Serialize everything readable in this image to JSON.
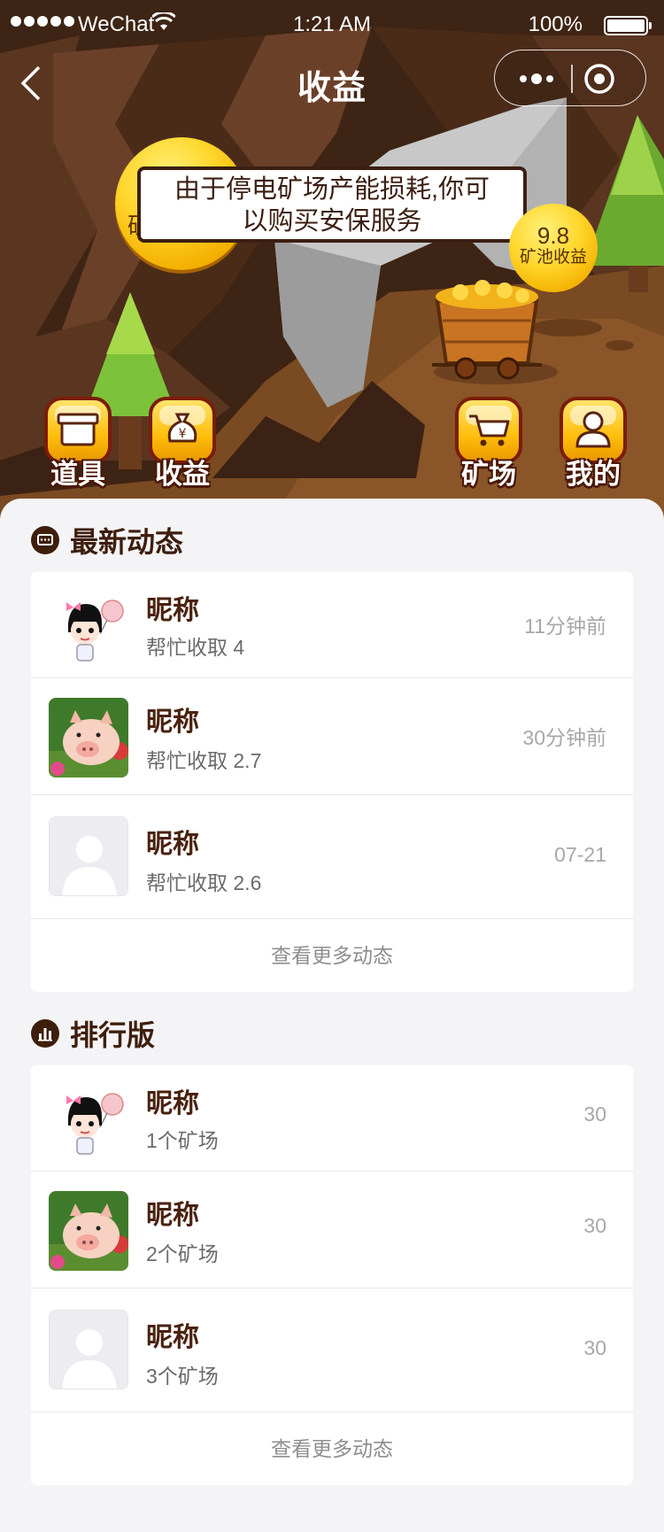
{
  "status_bar": {
    "carrier": "WeChat",
    "time": "1:21 AM",
    "battery": "100%"
  },
  "nav": {
    "title": "收益",
    "back_icon": "chevron-left-icon",
    "more_icon": "more-dots-icon",
    "close_icon": "target-circle-icon"
  },
  "hero": {
    "tooltip_text": "由于停电矿场产能损耗,你可以购买安保服务",
    "tooltip_close": "×",
    "coin_partial_text": "矿",
    "pool_value": "9.8",
    "pool_label": "矿池收益"
  },
  "menu": [
    {
      "label": "道具",
      "icon": "box-icon"
    },
    {
      "label": "收益",
      "icon": "money-bag-icon"
    },
    {
      "label": "矿场",
      "icon": "cart-icon"
    },
    {
      "label": "我的",
      "icon": "user-icon"
    }
  ],
  "activity": {
    "title": "最新动态",
    "icon": "chat-icon",
    "items": [
      {
        "name": "昵称",
        "sub": "帮忙收取 4",
        "time": "11分钟前",
        "avatar": "cartoon-girl-avatar"
      },
      {
        "name": "昵称",
        "sub": "帮忙收取 2.7",
        "time": "30分钟前",
        "avatar": "pig-avatar"
      },
      {
        "name": "昵称",
        "sub": "帮忙收取 2.6",
        "time": "07-21",
        "avatar": "default-avatar"
      }
    ],
    "more": "查看更多动态"
  },
  "ranking": {
    "title": "排行版",
    "icon": "bar-chart-icon",
    "items": [
      {
        "name": "昵称",
        "sub": "1个矿场",
        "value": "30",
        "avatar": "cartoon-girl-avatar"
      },
      {
        "name": "昵称",
        "sub": "2个矿场",
        "value": "30",
        "avatar": "pig-avatar"
      },
      {
        "name": "昵称",
        "sub": "3个矿场",
        "value": "30",
        "avatar": "default-avatar"
      }
    ],
    "more": "查看更多动态"
  },
  "colors": {
    "brown": "#3e1e0c",
    "gold": "#ffc81e",
    "bg": "#f4f4f6"
  }
}
